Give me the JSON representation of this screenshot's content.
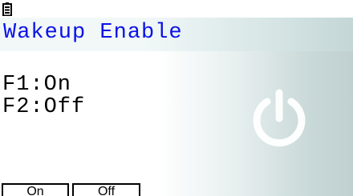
{
  "status_bar": {
    "battery_icon": "battery-icon"
  },
  "title": "Wakeup Enable",
  "options": [
    "F1:On",
    "F2:Off"
  ],
  "background_icon": "power-icon",
  "function_keys": [
    {
      "label": "On"
    },
    {
      "label": "Off"
    }
  ],
  "colors": {
    "title": "#0a12e8",
    "text": "#000000",
    "power_icon": "#ffffff"
  }
}
